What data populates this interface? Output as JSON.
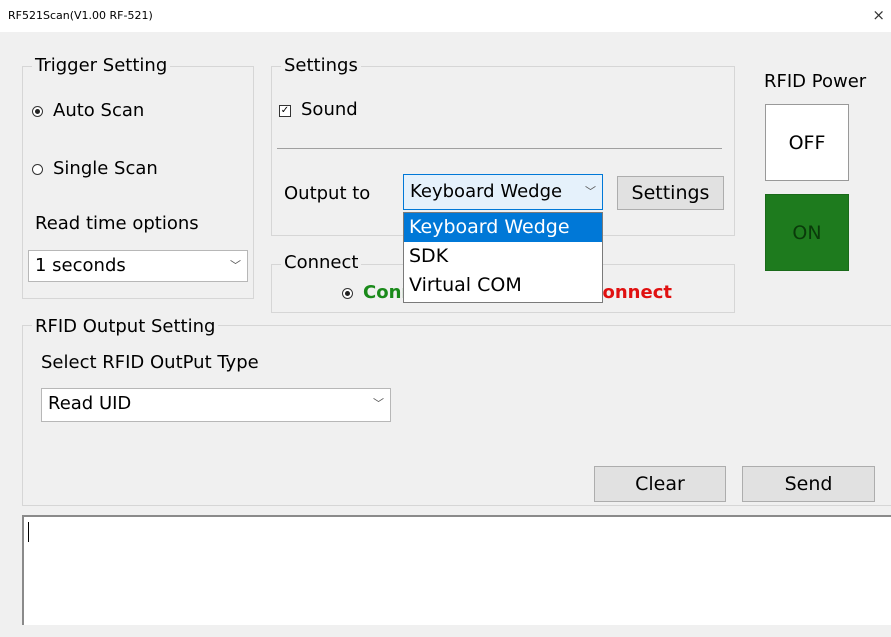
{
  "window": {
    "title": "RF521Scan(V1.00 RF-521)",
    "close_glyph": "×"
  },
  "trigger": {
    "title": "Trigger Setting",
    "auto_scan": "Auto Scan",
    "single_scan": "Single Scan",
    "selected": "auto_scan",
    "read_time_label": "Read time options",
    "read_time_value": "1 seconds"
  },
  "settings": {
    "title": "Settings",
    "sound_label": "Sound",
    "sound_checked": true,
    "output_label": "Output to",
    "output_value": "Keyboard Wedge",
    "settings_button": "Settings",
    "output_options": [
      "Keyboard Wedge",
      "SDK",
      "Virtual COM"
    ],
    "output_selected_index": 0
  },
  "connect": {
    "title": "Connect",
    "connect_label": "Connect",
    "disconnect_label": "Disconnect",
    "connect_color": "#1a8a1a",
    "disconnect_color": "#e01010",
    "selected": "connect"
  },
  "rfid_power": {
    "title": "RFID Power",
    "off_label": "OFF",
    "on_label": "ON",
    "on_color": "#1e7b1e"
  },
  "rfid_output": {
    "title": "RFID Output Setting",
    "select_label": "Select RFID OutPut Type",
    "type_value": "Read UID",
    "clear_button": "Clear",
    "send_button": "Send"
  },
  "log": {
    "text": ""
  }
}
